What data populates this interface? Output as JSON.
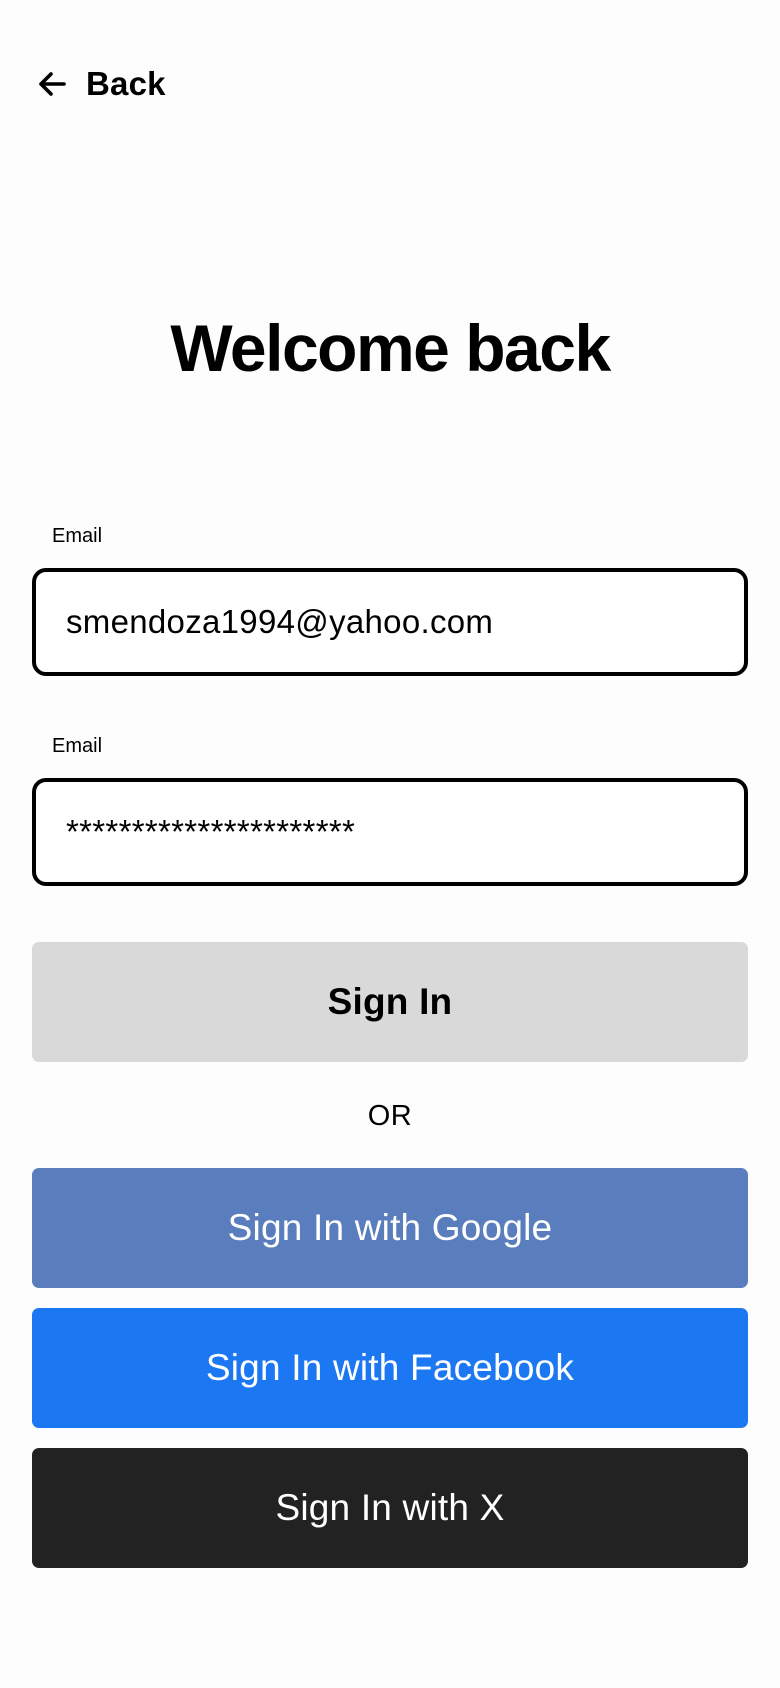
{
  "header": {
    "back_label": "Back",
    "back_icon": "arrow-left-icon"
  },
  "title": "Welcome back",
  "form": {
    "email": {
      "label": "Email",
      "value": "smendoza1994@yahoo.com"
    },
    "password": {
      "label": "Email",
      "value": "**********************"
    }
  },
  "buttons": {
    "sign_in": "Sign In",
    "divider": "OR",
    "google": "Sign In with Google",
    "facebook": "Sign In with Facebook",
    "x": "Sign In with X"
  },
  "colors": {
    "sign_in_bg": "#d9d9d9",
    "google_bg": "#5a7ebd",
    "facebook_bg": "#1b78f2",
    "x_bg": "#222222"
  }
}
